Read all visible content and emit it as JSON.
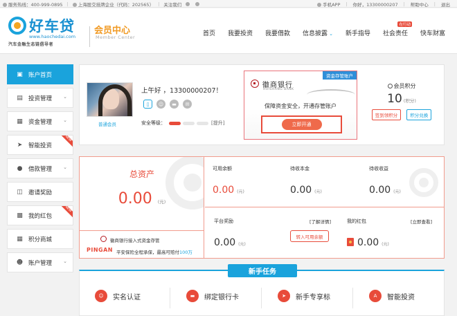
{
  "topbar": {
    "hotline": "服务热线：400-999-0895",
    "listed": "上海股交挂牌企业（代码：202565）",
    "follow": "关注我们",
    "app": "手机APP",
    "user": "你好，13300000207",
    "help": "帮助中心",
    "logout": "退出"
  },
  "brand": {
    "name": "好车贷",
    "url": "www.haochedai.com",
    "slogan": "汽车金融生态链倡导者",
    "member": "会员中心",
    "member_en": "Member Center"
  },
  "nav": {
    "items": [
      {
        "label": "首页"
      },
      {
        "label": "我要投资"
      },
      {
        "label": "我要借款"
      },
      {
        "label": "信息披露"
      },
      {
        "label": "新手指导"
      },
      {
        "label": "社会责任"
      },
      {
        "label": "快车财富"
      }
    ],
    "badge": "在行动"
  },
  "sidebar": {
    "items": [
      {
        "label": "账户首页",
        "icon": "monitor-icon"
      },
      {
        "label": "投资管理",
        "icon": "invest-icon"
      },
      {
        "label": "资金管理",
        "icon": "funds-icon"
      },
      {
        "label": "智能投资",
        "icon": "rocket-icon"
      },
      {
        "label": "借款管理",
        "icon": "loan-icon"
      },
      {
        "label": "邀请奖励",
        "icon": "gift-icon"
      },
      {
        "label": "我的红包",
        "icon": "redpacket-icon"
      },
      {
        "label": "积分商城",
        "icon": "mall-icon"
      },
      {
        "label": "账户管理",
        "icon": "user-icon"
      }
    ],
    "new_tag": "NEW"
  },
  "profile": {
    "greeting": "上午好 ，13300000207！",
    "level": "普通会员",
    "security_label": "安全等级：",
    "upgrade": "[提升]"
  },
  "bank": {
    "tag": "资金存管账户",
    "name": "徽商银行",
    "name_en": "HUISHANG BANK",
    "text": "保障资金安全，开通存管账户",
    "button": "立即开通"
  },
  "points": {
    "label": "会员积分",
    "value": "10",
    "unit": "(积分)",
    "signin": "签到领积分",
    "exchange": "积分兑换"
  },
  "assets": {
    "title": "总资产",
    "total": "0.00",
    "unit": "(元)",
    "deposit_line": "徽商银行接入式资金存管",
    "pingan": "PINGAN",
    "insure_text": "平安保险全程承保，最高可赔付",
    "insure_amount": "100万",
    "available_label": "可用余额",
    "available_value": "0.00",
    "pending_principal_label": "待收本金",
    "pending_principal_value": "0.00",
    "pending_income_label": "待收收益",
    "pending_income_value": "0.00",
    "reward_label": "平台奖励",
    "reward_link": "[了解详情]",
    "reward_value": "0.00",
    "to_balance": "转入可用余额",
    "redpacket_label": "我的红包",
    "redpacket_link": "[立即查看]",
    "redpacket_value": "0.00"
  },
  "tasks": {
    "title": "新手任务",
    "items": [
      {
        "label": "实名认证"
      },
      {
        "label": "绑定银行卡"
      },
      {
        "label": "新手专享标"
      },
      {
        "label": "智能投资"
      }
    ]
  }
}
